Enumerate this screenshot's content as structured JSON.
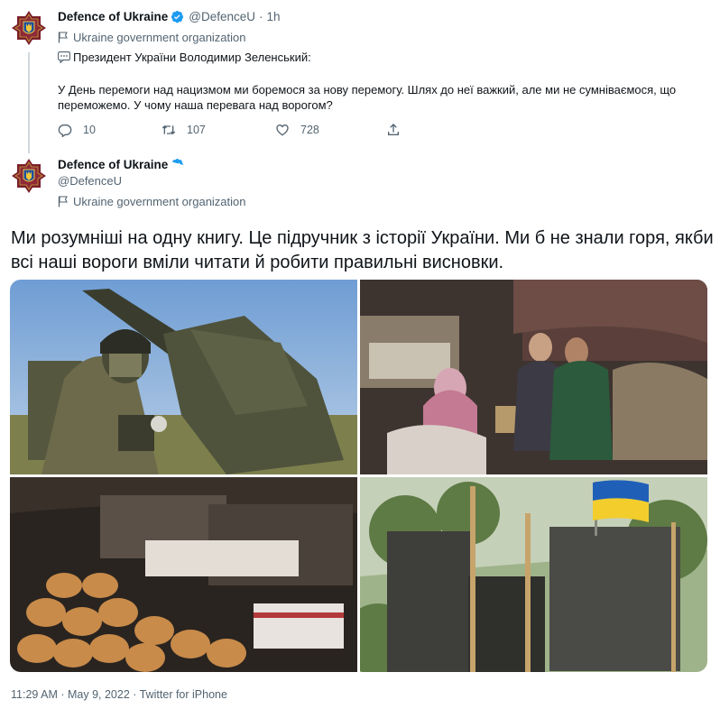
{
  "colors": {
    "accent": "#1d9bf0",
    "text": "#0f1419",
    "muted": "#536471",
    "thread": "#cfd9de"
  },
  "reply_tweet": {
    "author_name": "Defence of Ukraine",
    "author_handle": "@DefenceU",
    "separator": "·",
    "time_ago": "1h",
    "org_label": "Ukraine government organization",
    "line1": "Президент України Володимир Зеленський:",
    "line2": "У День перемоги над нацизмом ми боремося за нову перемогу. Шлях до неї важкий, але ми не сумніваємося, що переможемо. У чому наша перевага над ворогом?",
    "replies": "10",
    "retweets": "107",
    "likes": "728",
    "icons": [
      "emblem-avatar-icon",
      "verified-badge-icon",
      "flag-icon",
      "speech-bubble-icon",
      "reply-icon",
      "retweet-icon",
      "like-icon",
      "share-icon"
    ]
  },
  "main_tweet": {
    "author_name": "Defence of Ukraine",
    "author_handle": "@DefenceU",
    "org_label": "Ukraine government organization",
    "text": "Ми розумніші на одну книгу. Це підручник з історії України. Ми б не знали горя, якби всі наші вороги вміли читати й робити правильні висновки.",
    "timestamp": "11:29 AM · May 9, 2022 · Twitter for iPhone"
  }
}
